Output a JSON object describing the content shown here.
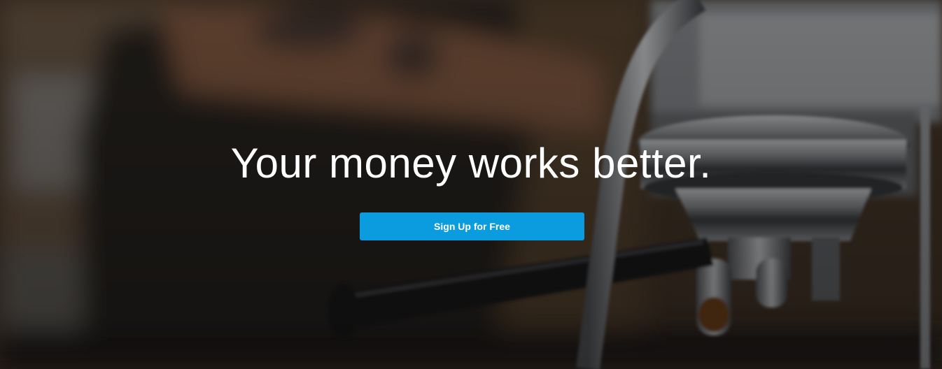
{
  "hero": {
    "headline": "Your money works better.",
    "cta_label": "Sign Up for Free"
  },
  "colors": {
    "cta_background": "#0b9bdf",
    "text": "#ffffff",
    "overlay": "#1a1714"
  }
}
